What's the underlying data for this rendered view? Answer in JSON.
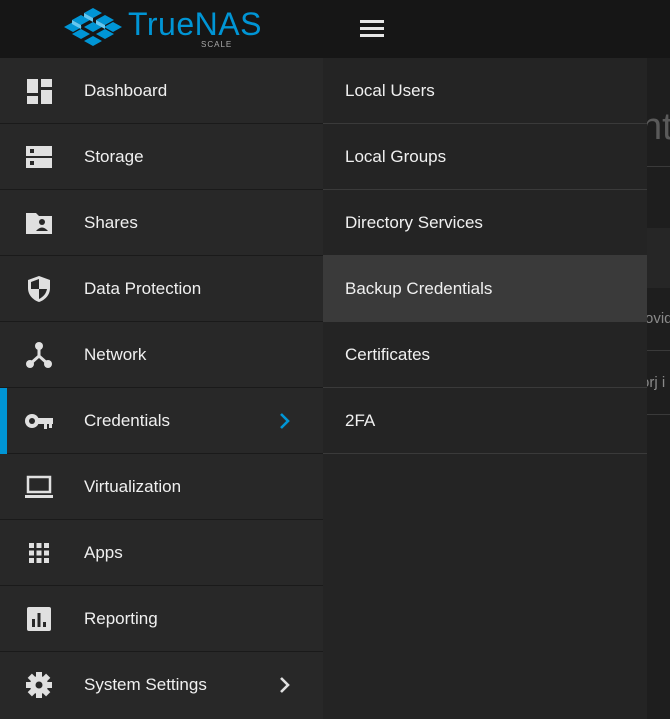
{
  "brand": {
    "name": "TrueNAS",
    "edition": "SCALE",
    "accent_color": "#0095d5"
  },
  "header": {
    "menu_icon": "hamburger-menu-icon"
  },
  "sidebar": {
    "items": [
      {
        "label": "Dashboard",
        "icon": "dashboard-icon"
      },
      {
        "label": "Storage",
        "icon": "storage-icon"
      },
      {
        "label": "Shares",
        "icon": "shares-icon"
      },
      {
        "label": "Data Protection",
        "icon": "shield-icon"
      },
      {
        "label": "Network",
        "icon": "network-icon"
      },
      {
        "label": "Credentials",
        "icon": "key-icon",
        "active": true,
        "has_submenu": true
      },
      {
        "label": "Virtualization",
        "icon": "laptop-icon"
      },
      {
        "label": "Apps",
        "icon": "apps-grid-icon"
      },
      {
        "label": "Reporting",
        "icon": "reporting-icon"
      },
      {
        "label": "System Settings",
        "icon": "gear-icon",
        "has_submenu": true
      }
    ]
  },
  "submenu": {
    "items": [
      {
        "label": "Local Users"
      },
      {
        "label": "Local Groups"
      },
      {
        "label": "Directory Services"
      },
      {
        "label": "Backup Credentials",
        "highlighted": true
      },
      {
        "label": "Certificates"
      },
      {
        "label": "2FA"
      }
    ]
  },
  "background_fragments": {
    "title": "nt",
    "row1": "ovid",
    "row2": "orj i"
  }
}
